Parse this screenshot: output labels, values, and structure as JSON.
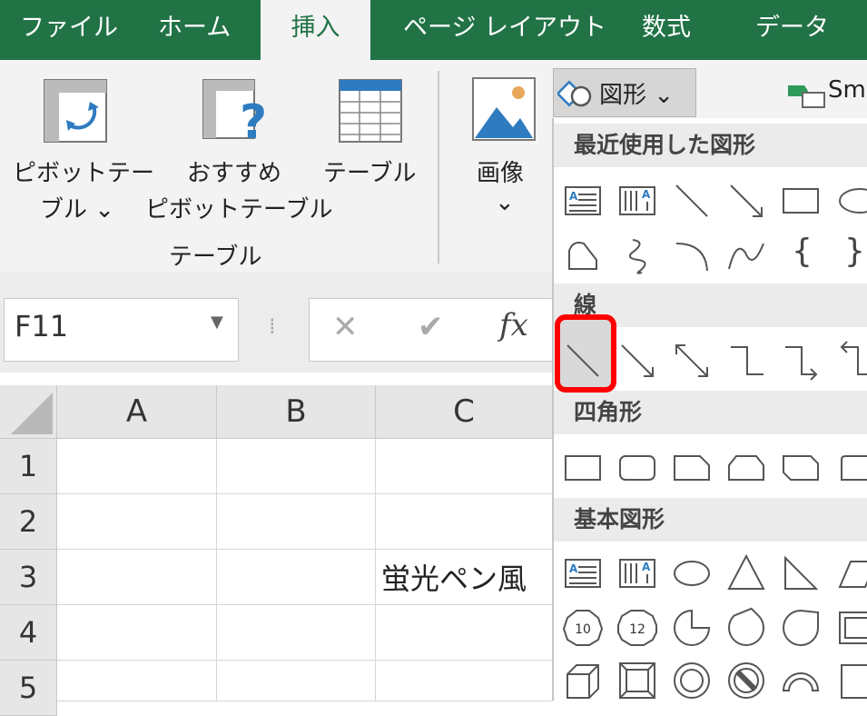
{
  "tabs": [
    "ファイル",
    "ホーム",
    "挿入",
    "ページ レイアウト",
    "数式",
    "データ"
  ],
  "active_tab": "挿入",
  "ribbon": {
    "pivot_table_line1": "ピボットテー",
    "pivot_table_line2": "ブル ⌄",
    "recommended_pivot_line1": "おすすめ",
    "recommended_pivot_line2": "ピボットテーブル",
    "table": "テーブル",
    "group_tables": "テーブル",
    "image": "画像",
    "image_caret": "⌄",
    "shapes_button": "図形 ⌄",
    "smartart_partial": "Sm"
  },
  "formula_bar": {
    "name_box": "F11",
    "cancel": "✕",
    "enter": "✔",
    "fx": "fx"
  },
  "grid": {
    "columns": [
      "A",
      "B",
      "C"
    ],
    "rows": [
      "1",
      "2",
      "3",
      "4",
      "5"
    ],
    "cell_c3": "蛍光ペン風"
  },
  "shapes_panel": {
    "sections": [
      "最近使用した図形",
      "線",
      "四角形",
      "基本図形"
    ],
    "recent_brace_open": "{",
    "recent_brace_close": "}",
    "octagon_10": "10",
    "octagon_12": "12",
    "highlighted": "line"
  },
  "colors": {
    "ribbon_green": "#217346",
    "highlight_red": "#ff0000"
  }
}
